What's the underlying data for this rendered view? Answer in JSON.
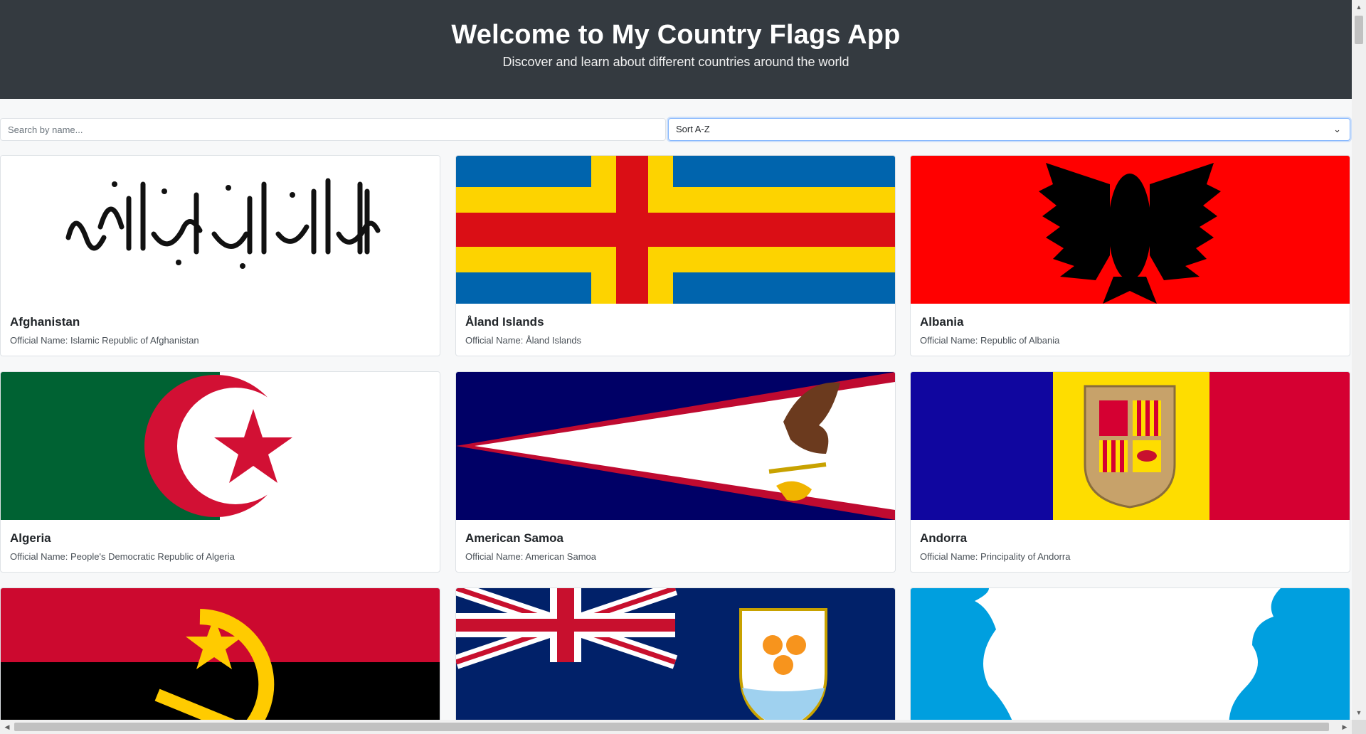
{
  "header": {
    "title": "Welcome to My Country Flags App",
    "subtitle": "Discover and learn about different countries around the world"
  },
  "controls": {
    "search_placeholder": "Search by name...",
    "sort_selected": "Sort A-Z"
  },
  "cards": [
    {
      "name": "Afghanistan",
      "official": "Official Name: Islamic Republic of Afghanistan",
      "flag": "afghanistan-flag"
    },
    {
      "name": "Åland Islands",
      "official": "Official Name: Åland Islands",
      "flag": "aland-flag"
    },
    {
      "name": "Albania",
      "official": "Official Name: Republic of Albania",
      "flag": "albania-flag"
    },
    {
      "name": "Algeria",
      "official": "Official Name: People's Democratic Republic of Algeria",
      "flag": "algeria-flag"
    },
    {
      "name": "American Samoa",
      "official": "Official Name: American Samoa",
      "flag": "american-samoa-flag"
    },
    {
      "name": "Andorra",
      "official": "Official Name: Principality of Andorra",
      "flag": "andorra-flag"
    },
    {
      "flag": "angola-flag"
    },
    {
      "flag": "anguilla-flag"
    },
    {
      "flag": "antarctica-flag"
    }
  ],
  "colors": {
    "header_bg": "#343a40",
    "page_bg": "#f7f8f9",
    "card_border": "#dee2e6",
    "focus_border": "#86b7fe"
  }
}
